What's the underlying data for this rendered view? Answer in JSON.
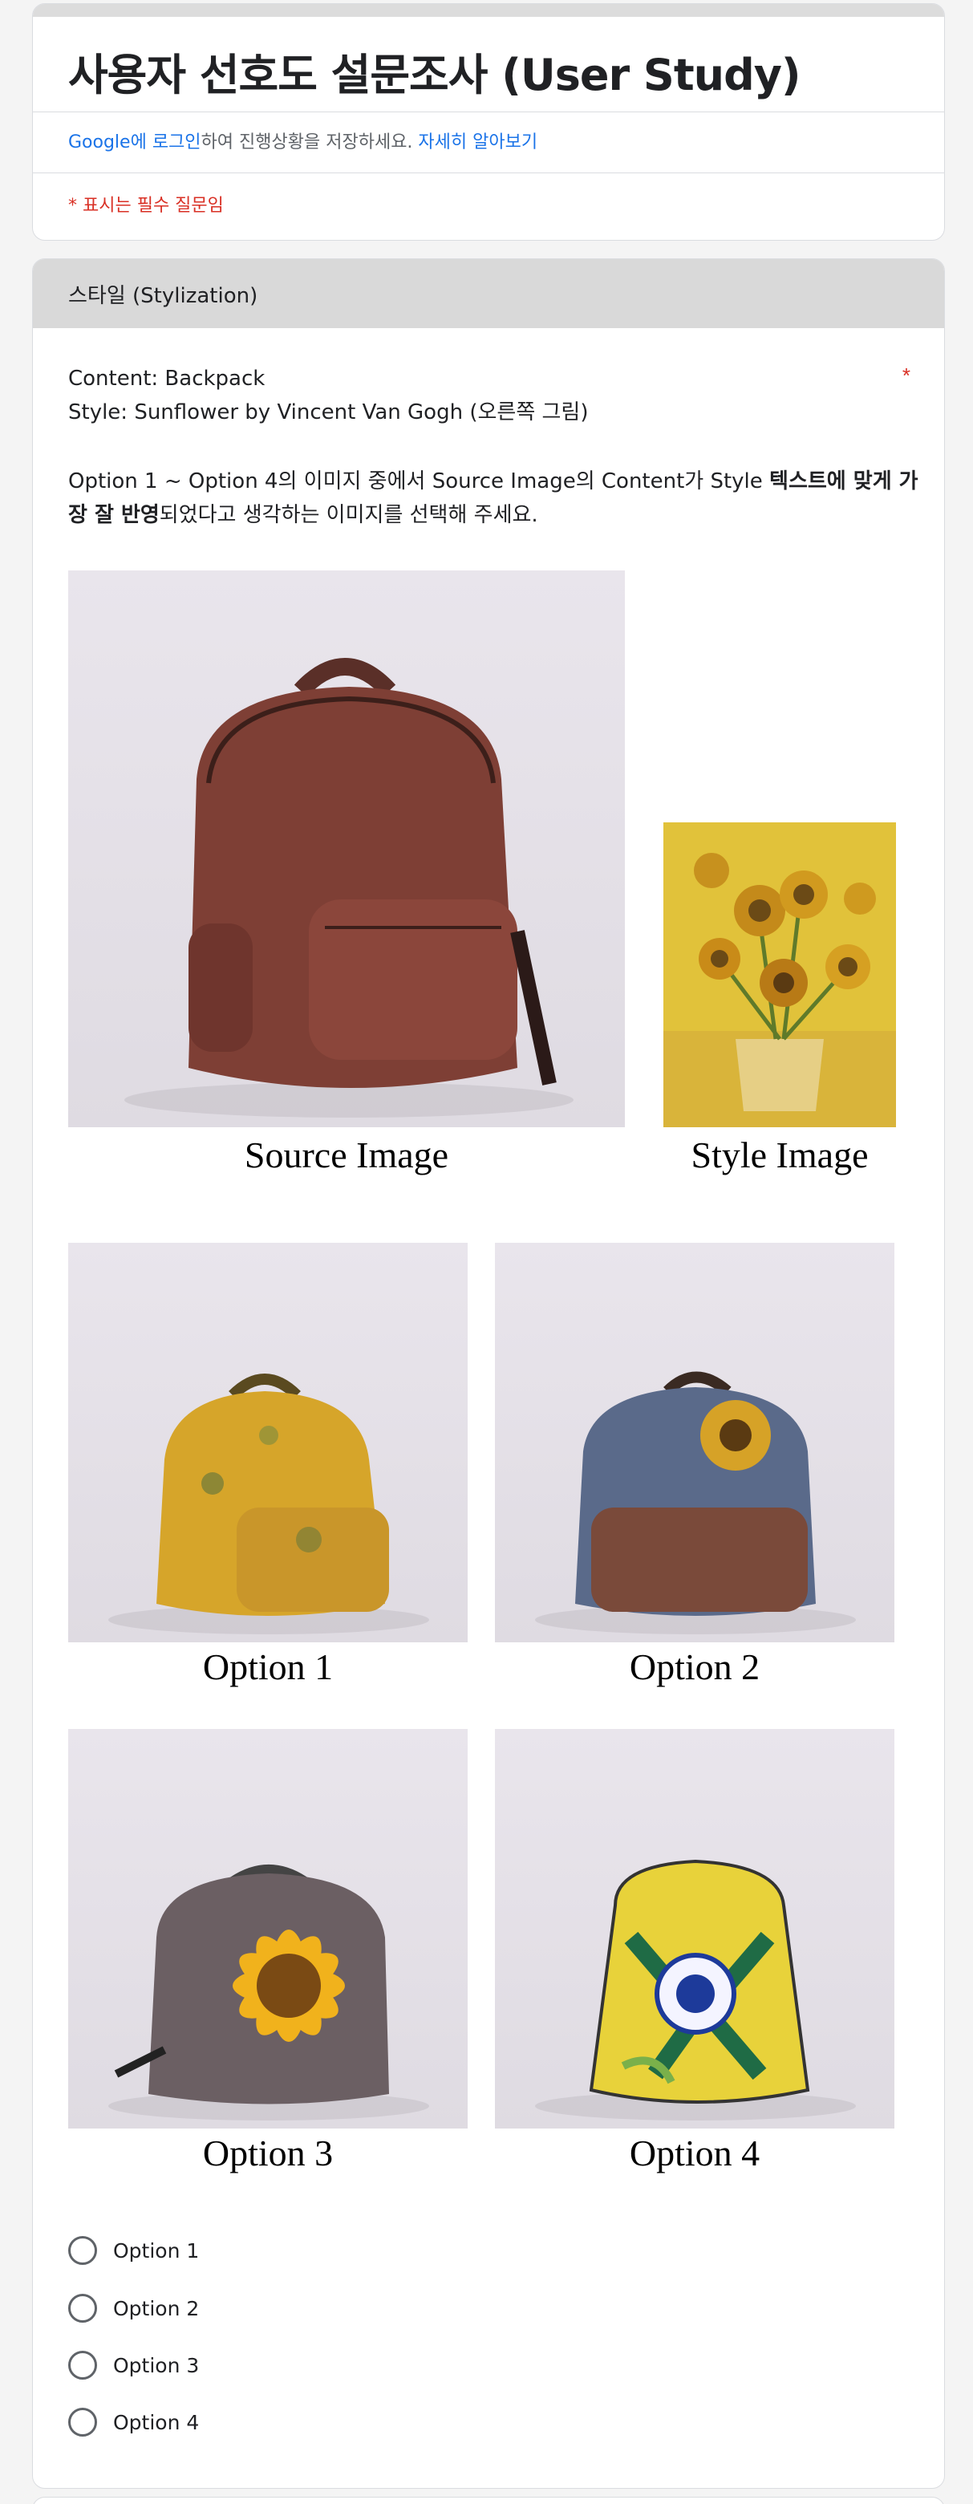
{
  "form": {
    "title": "사용자 선호도 설문조사 (User Study)",
    "login_google": "Google에 ",
    "login_link": "로그인",
    "login_rest": "하여 진행상황을 저장하세요. ",
    "learn_more": "자세히 알아보기",
    "required_note": "* 표시는 필수 질문임"
  },
  "section": {
    "title": "스타일 (Stylization)"
  },
  "question": {
    "content_line": "Content: Backpack",
    "style_line": "Style: Sunflower by Vincent Van Gogh (오른쪽 그림)",
    "required_mark": "*",
    "instr_part1": "Option 1 ~ Option 4의 이미지 중에서 Source Image의 Content가 Style ",
    "instr_bold1": "텍스트에 맞게 가장 잘 반영",
    "instr_part2": "되었다고 생각하는 이미지를 선택해 주세요."
  },
  "figure": {
    "source_caption": "Source Image",
    "style_caption": "Style Image",
    "option_captions": [
      "Option 1",
      "Option 2",
      "Option 3",
      "Option 4"
    ]
  },
  "choices": [
    "Option 1",
    "Option 2",
    "Option 3",
    "Option 4"
  ],
  "colors": {
    "link": "#1a73e8",
    "required": "#d93025",
    "section_header_bg": "#d9d9d9"
  }
}
